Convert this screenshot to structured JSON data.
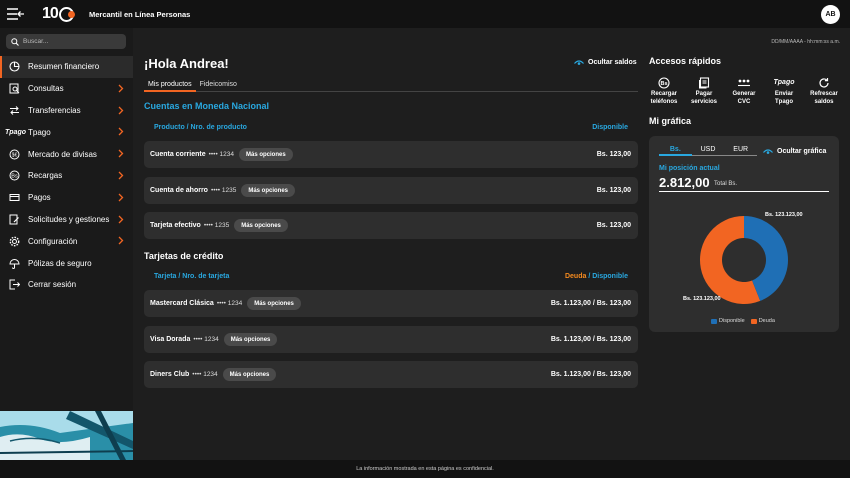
{
  "app": {
    "logo_text": "10",
    "title": "Mercantil en Línea Personas",
    "avatar": "AB"
  },
  "search": {
    "placeholder": "Buscar..."
  },
  "sidebar": {
    "items": [
      {
        "label": "Resumen financiero",
        "icon": "chart-pie-icon",
        "active": true,
        "chevron": false
      },
      {
        "label": "Consultas",
        "icon": "magnify-doc-icon",
        "chevron": true
      },
      {
        "label": "Transferencias",
        "icon": "transfer-icon",
        "chevron": true
      },
      {
        "label": "Tpago",
        "icon": "tpago-icon",
        "chevron": true
      },
      {
        "label": "Mercado de divisas",
        "icon": "currency-icon",
        "chevron": true
      },
      {
        "label": "Recargas",
        "icon": "recharge-icon",
        "chevron": true
      },
      {
        "label": "Pagos",
        "icon": "payment-icon",
        "chevron": true
      },
      {
        "label": "Solicitudes y gestiones",
        "icon": "edit-doc-icon",
        "chevron": true
      },
      {
        "label": "Configuración",
        "icon": "gear-icon",
        "chevron": true
      },
      {
        "label": "Pólizas de seguro",
        "icon": "umbrella-icon",
        "chevron": false
      },
      {
        "label": "Cerrar sesión",
        "icon": "logout-icon",
        "chevron": false
      }
    ],
    "tpago_logo": "Tpago"
  },
  "main": {
    "date_stamp": "DD/MM/AAAA - hh:mm:ss a.m.",
    "greeting": "¡Hola Andrea!",
    "hide_balances": "Ocultar saldos",
    "tabs": [
      "Mis productos",
      "Fideicomiso"
    ],
    "accounts": {
      "title": "Cuentas en Moneda Nacional",
      "col_product": "Producto / Nro. de producto",
      "col_balance": "Disponible",
      "rows": [
        {
          "name": "Cuenta corriente",
          "number": "•••• 1234",
          "action": "Más opciones",
          "amount": "Bs. 123,00"
        },
        {
          "name": "Cuenta de ahorro",
          "number": "•••• 1235",
          "action": "Más opciones",
          "amount": "Bs. 123,00"
        },
        {
          "name": "Tarjeta efectivo",
          "number": "•••• 1235",
          "action": "Más opciones",
          "amount": "Bs. 123,00"
        }
      ]
    },
    "cards": {
      "title": "Tarjetas de crédito",
      "col_card": "Tarjeta / Nro. de tarjeta",
      "col_debt": "Deuda",
      "col_sep": " / ",
      "col_available": "Disponible",
      "rows": [
        {
          "name": "Mastercard Clásica",
          "number": "•••• 1234",
          "action": "Más opciones",
          "amount": "Bs. 1.123,00 / Bs. 123,00"
        },
        {
          "name": "Visa Dorada",
          "number": "•••• 1234",
          "action": "Más opciones",
          "amount": "Bs. 1.123,00 / Bs. 123,00"
        },
        {
          "name": "Diners Club",
          "number": "•••• 1234",
          "action": "Más opciones",
          "amount": "Bs. 1.123,00 / Bs. 123,00"
        }
      ]
    }
  },
  "quick_access": {
    "title": "Accesos rápidos",
    "items": [
      {
        "label1": "Recargar",
        "label2": "teléfonos",
        "icon": "phone-recharge-icon"
      },
      {
        "label1": "Pagar",
        "label2": "servicios",
        "icon": "receipt-icon"
      },
      {
        "label1": "Generar",
        "label2": "CVC",
        "icon": "cvc-icon"
      },
      {
        "label1": "Enviar",
        "label2": "Tpago",
        "icon": "tpago-send-icon",
        "logo": "Tpago"
      },
      {
        "label1": "Refrescar",
        "label2": "saldos",
        "icon": "refresh-icon"
      }
    ]
  },
  "graph": {
    "title": "Mi gráfica",
    "currencies": [
      "Bs.",
      "USD",
      "EUR"
    ],
    "hide_graph": "Ocultar gráfica",
    "position_label": "Mi posición actual",
    "position_value": "2.812,00",
    "position_unit": "Total Bs.",
    "label_available": "Bs. 123.123,00",
    "label_debt": "Bs. 123.123,00"
  },
  "chart_data": {
    "type": "pie",
    "categories": [
      "Disponible",
      "Deuda"
    ],
    "values": [
      123123,
      123123
    ],
    "shown_share": [
      0.44,
      0.56
    ],
    "colors": [
      "#1f6fb5",
      "#f26522"
    ],
    "legend_placement": "bottom"
  },
  "footer": {
    "text": "La información mostrada en esta página es confidencial."
  }
}
